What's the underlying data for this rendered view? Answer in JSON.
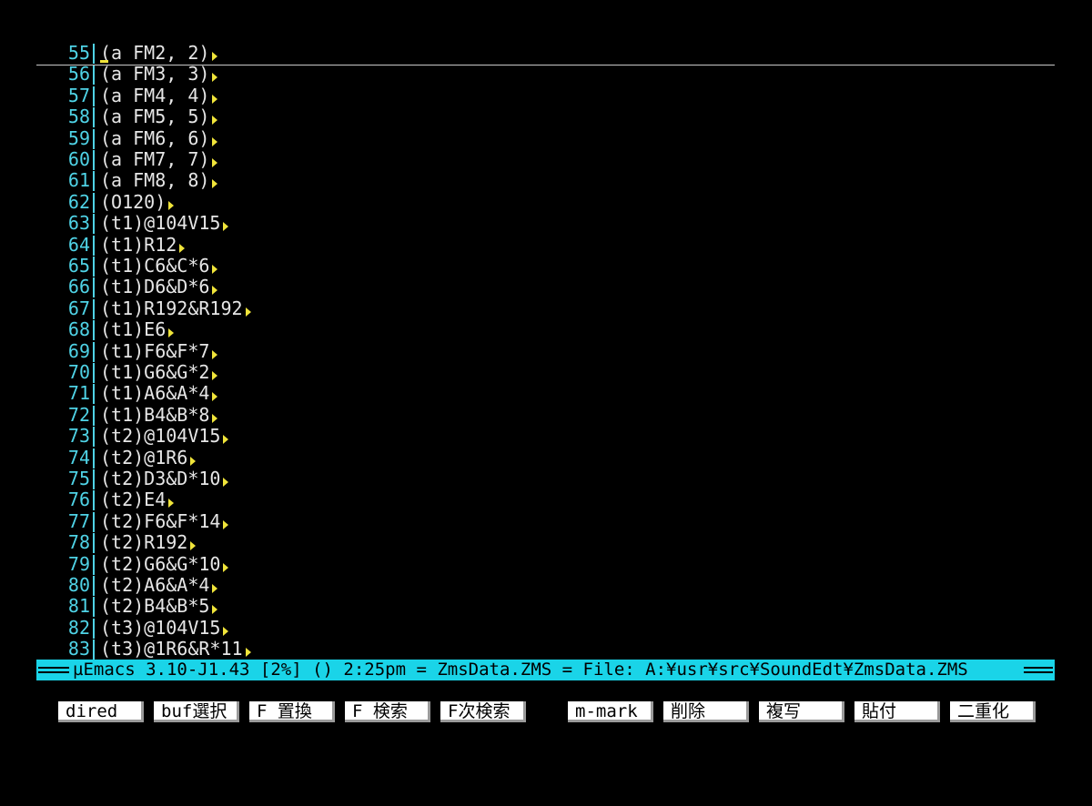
{
  "colors": {
    "background": "#000000",
    "line_number": "#4fd3e6",
    "text": "#e6e6e6",
    "eol_marker": "#f0e43a",
    "modeline_bg": "#1ad4e8",
    "fkey_bg": "#ffffff"
  },
  "editor": {
    "lines": [
      {
        "num": "55",
        "text": "(a FM2, 2)"
      },
      {
        "num": "56",
        "text": "(a FM3, 3)"
      },
      {
        "num": "57",
        "text": "(a FM4, 4)"
      },
      {
        "num": "58",
        "text": "(a FM5, 5)"
      },
      {
        "num": "59",
        "text": "(a FM6, 6)"
      },
      {
        "num": "60",
        "text": "(a FM7, 7)"
      },
      {
        "num": "61",
        "text": "(a FM8, 8)"
      },
      {
        "num": "62",
        "text": "(O120)"
      },
      {
        "num": "63",
        "text": "(t1)@104V15"
      },
      {
        "num": "64",
        "text": "(t1)R12"
      },
      {
        "num": "65",
        "text": "(t1)C6&C*6"
      },
      {
        "num": "66",
        "text": "(t1)D6&D*6"
      },
      {
        "num": "67",
        "text": "(t1)R192&R192"
      },
      {
        "num": "68",
        "text": "(t1)E6"
      },
      {
        "num": "69",
        "text": "(t1)F6&F*7"
      },
      {
        "num": "70",
        "text": "(t1)G6&G*2"
      },
      {
        "num": "71",
        "text": "(t1)A6&A*4"
      },
      {
        "num": "72",
        "text": "(t1)B4&B*8"
      },
      {
        "num": "73",
        "text": "(t2)@104V15"
      },
      {
        "num": "74",
        "text": "(t2)@1R6"
      },
      {
        "num": "75",
        "text": "(t2)D3&D*10"
      },
      {
        "num": "76",
        "text": "(t2)E4"
      },
      {
        "num": "77",
        "text": "(t2)F6&F*14"
      },
      {
        "num": "78",
        "text": "(t2)R192"
      },
      {
        "num": "79",
        "text": "(t2)G6&G*10"
      },
      {
        "num": "80",
        "text": "(t2)A6&A*4"
      },
      {
        "num": "81",
        "text": "(t2)B4&B*5"
      },
      {
        "num": "82",
        "text": "(t3)@104V15"
      },
      {
        "num": "83",
        "text": "(t3)@1R6&R*11"
      }
    ]
  },
  "modeline": {
    "text": "µEmacs 3.10-J1.43 [2%] () 2:25pm = ZmsData.ZMS = File: A:¥usr¥src¥SoundEdt¥ZmsData.ZMS"
  },
  "fkeys": [
    {
      "label": "dired"
    },
    {
      "label": "buf選択"
    },
    {
      "label": "F 置換"
    },
    {
      "label": "F 検索"
    },
    {
      "label": "F次検索"
    },
    {
      "label": "m-mark"
    },
    {
      "label": "削除"
    },
    {
      "label": "複写"
    },
    {
      "label": "貼付"
    },
    {
      "label": "二重化"
    }
  ]
}
